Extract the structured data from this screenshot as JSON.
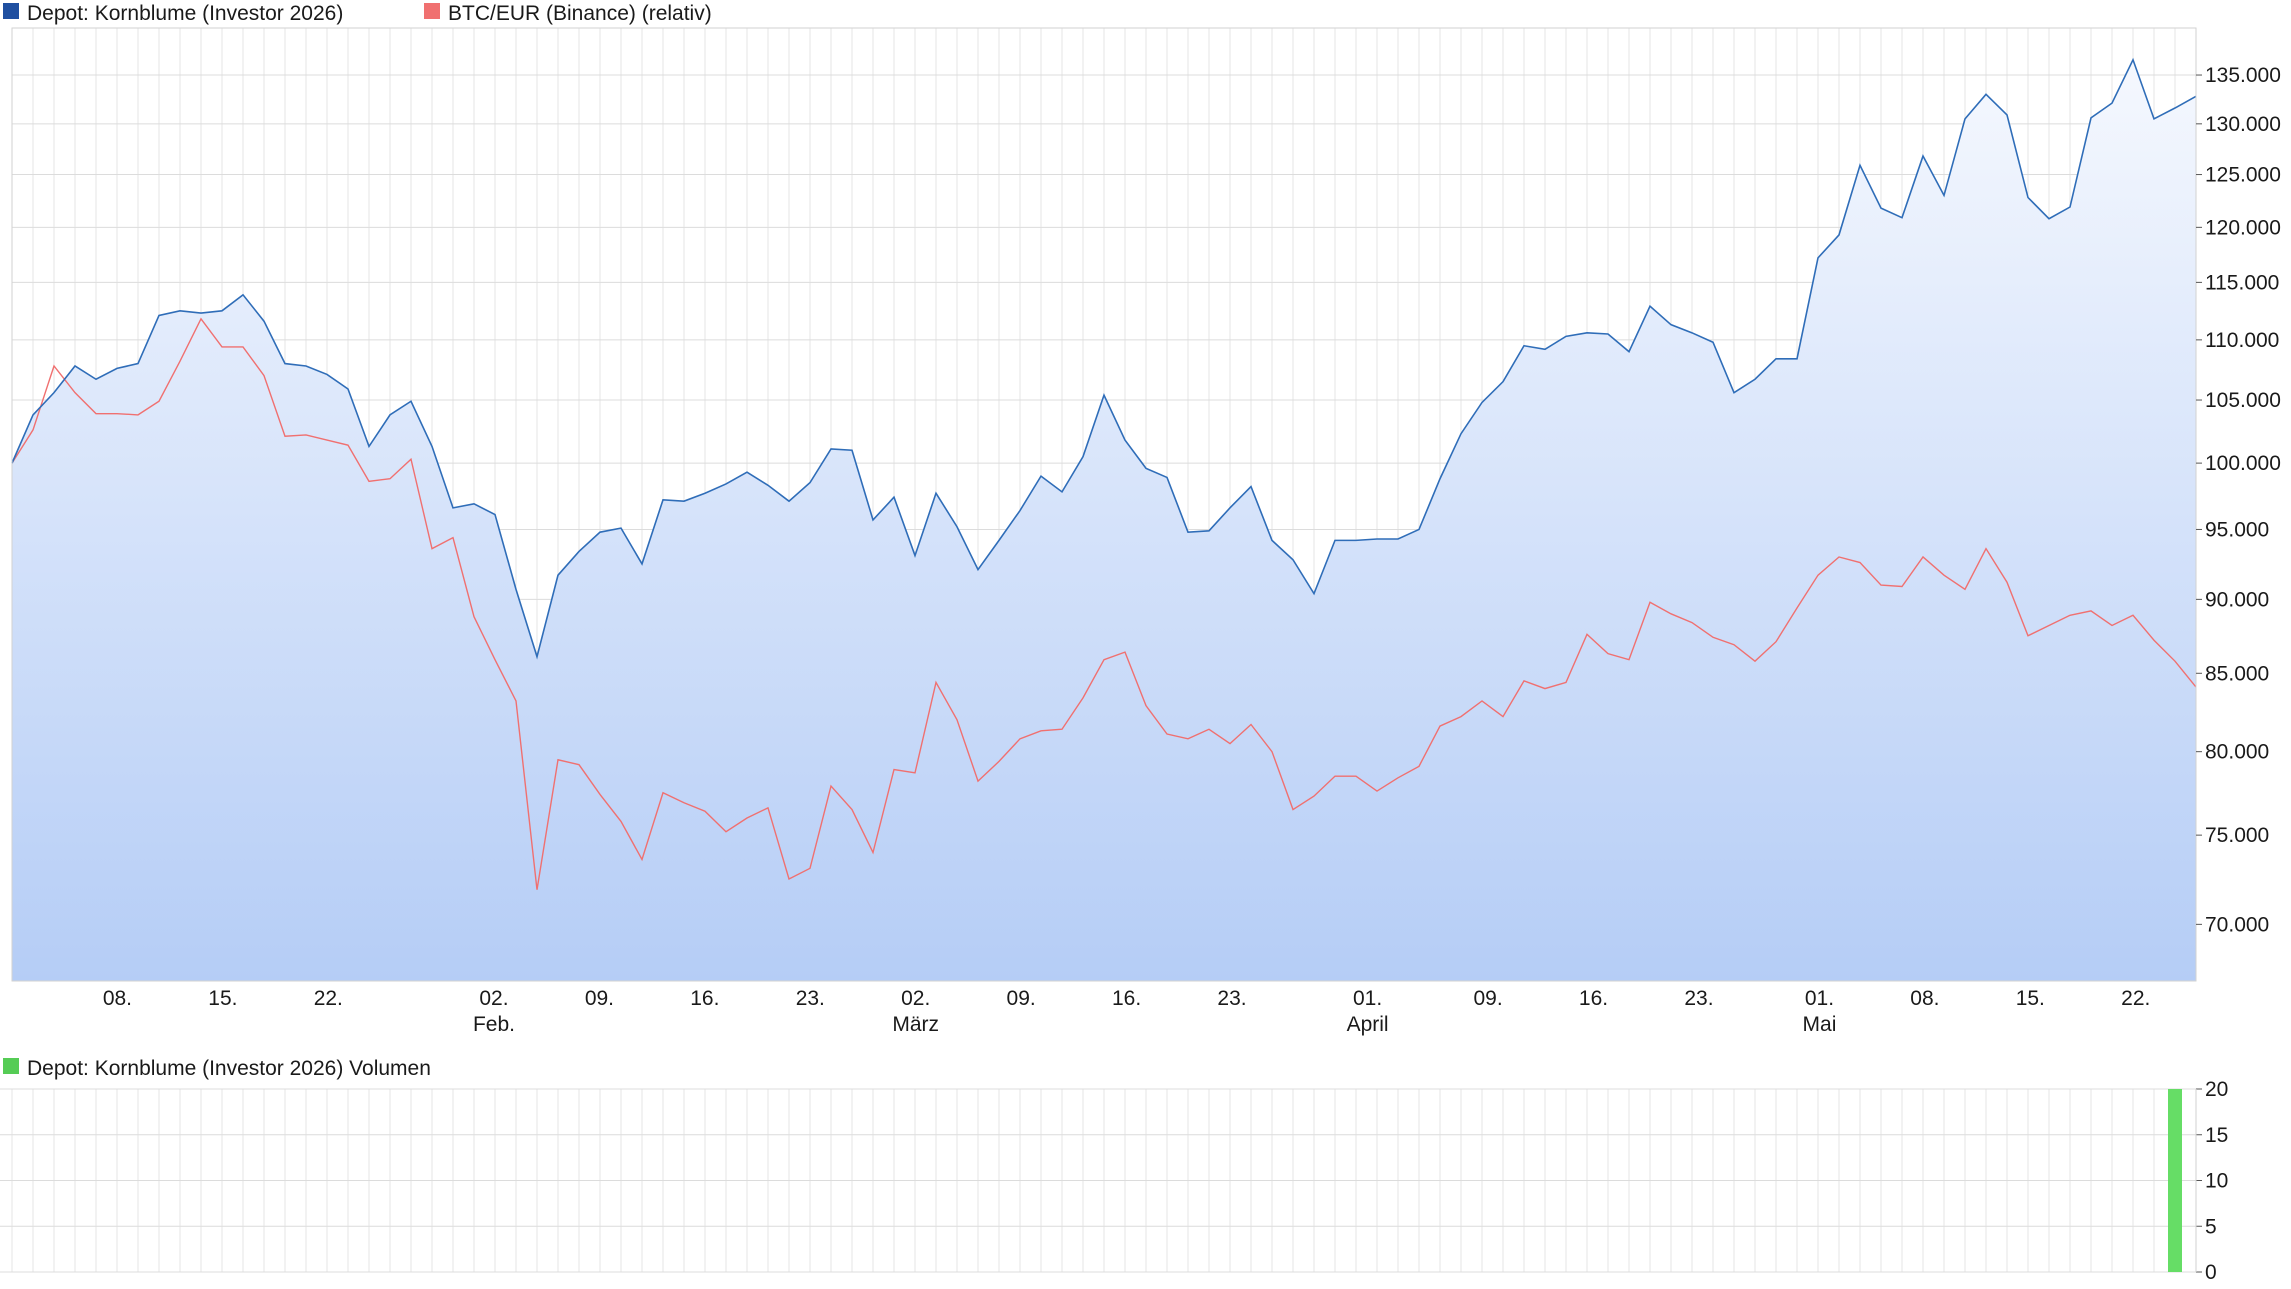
{
  "chart_data": [
    {
      "type": "line",
      "legend_position": "top-left",
      "grid": true,
      "y_scale": "log",
      "ylim": [
        67000,
        140000
      ],
      "y_ticks": [
        "70.000",
        "75.000",
        "80.000",
        "85.000",
        "90.000",
        "95.000",
        "100.000",
        "105.000",
        "110.000",
        "115.000",
        "120.000",
        "125.000",
        "130.000",
        "135.000"
      ],
      "y_tick_values": [
        70000,
        75000,
        80000,
        85000,
        90000,
        95000,
        100000,
        105000,
        110000,
        115000,
        120000,
        125000,
        130000,
        135000
      ],
      "x_ticks": [
        {
          "day": "08.",
          "month": "",
          "date": "2026-01-08"
        },
        {
          "day": "15.",
          "month": "",
          "date": "2026-01-15"
        },
        {
          "day": "22.",
          "month": "",
          "date": "2026-01-22"
        },
        {
          "day": "02.",
          "month": "Feb.",
          "date": "2026-02-02"
        },
        {
          "day": "09.",
          "month": "",
          "date": "2026-02-09"
        },
        {
          "day": "16.",
          "month": "",
          "date": "2026-02-16"
        },
        {
          "day": "23.",
          "month": "",
          "date": "2026-02-23"
        },
        {
          "day": "02.",
          "month": "März",
          "date": "2026-03-02"
        },
        {
          "day": "09.",
          "month": "",
          "date": "2026-03-09"
        },
        {
          "day": "16.",
          "month": "",
          "date": "2026-03-16"
        },
        {
          "day": "23.",
          "month": "",
          "date": "2026-03-23"
        },
        {
          "day": "01.",
          "month": "April",
          "date": "2026-04-01"
        },
        {
          "day": "09.",
          "month": "",
          "date": "2026-04-09"
        },
        {
          "day": "16.",
          "month": "",
          "date": "2026-04-16"
        },
        {
          "day": "23.",
          "month": "",
          "date": "2026-04-23"
        },
        {
          "day": "01.",
          "month": "Mai",
          "date": "2026-05-01"
        },
        {
          "day": "08.",
          "month": "",
          "date": "2026-05-08"
        },
        {
          "day": "15.",
          "month": "",
          "date": "2026-05-15"
        },
        {
          "day": "22.",
          "month": "",
          "date": "2026-05-22"
        }
      ],
      "series": [
        {
          "name": "Depot: Kornblume (Investor 2026)",
          "color": "#2f6db8",
          "fill_top": "#f5f8fe",
          "fill_bottom": "#b5cdf6",
          "legend_color": "#1f4fa0",
          "values": [
            100000,
            103800,
            105600,
            107800,
            106700,
            107600,
            108000,
            112100,
            112500,
            112300,
            112500,
            113900,
            111600,
            108000,
            107800,
            107100,
            105900,
            101300,
            103800,
            104900,
            101300,
            96600,
            96900,
            96100,
            90700,
            86100,
            91700,
            93400,
            94800,
            95100,
            92500,
            97200,
            97100,
            97700,
            98400,
            99300,
            98300,
            97100,
            98500,
            101100,
            101000,
            95700,
            97400,
            93100,
            97700,
            95200,
            92100,
            94200,
            96400,
            99000,
            97800,
            100500,
            105400,
            101800,
            99600,
            98900,
            94800,
            94900,
            96600,
            98200,
            94200,
            92800,
            90400,
            94200,
            94200,
            94300,
            94300,
            95000,
            98800,
            102300,
            104800,
            106500,
            109500,
            109200,
            110300,
            110600,
            110500,
            109000,
            112900,
            111300,
            110600,
            109800,
            105600,
            106700,
            108400,
            108400,
            117200,
            119300,
            125900,
            121800,
            120900,
            126800,
            123000,
            130500,
            133000,
            130900,
            122800,
            120800,
            121900,
            130600,
            132100,
            136600,
            130500,
            131600,
            132800
          ]
        },
        {
          "name": "BTC/EUR (Binance) (relativ)",
          "color": "#f07070",
          "legend_color": "#f07070",
          "values": [
            100000,
            102600,
            107800,
            105600,
            103900,
            103900,
            103800,
            104900,
            108200,
            111800,
            109400,
            109400,
            107000,
            102100,
            102200,
            101800,
            101400,
            98600,
            98800,
            100300,
            93600,
            94400,
            88800,
            85900,
            83200,
            71900,
            79500,
            79200,
            77400,
            75800,
            73600,
            77500,
            76900,
            76400,
            75200,
            76000,
            76600,
            72500,
            73100,
            77900,
            76500,
            74000,
            78900,
            78700,
            84400,
            82000,
            78200,
            79400,
            80800,
            81300,
            81400,
            83400,
            85900,
            86400,
            82900,
            81100,
            80800,
            81400,
            80500,
            81700,
            80000,
            76500,
            77300,
            78500,
            78500,
            77600,
            78400,
            79100,
            81600,
            82200,
            83200,
            82200,
            84500,
            84000,
            84400,
            87600,
            86300,
            85900,
            89800,
            89000,
            88400,
            87400,
            86900,
            85800,
            87100,
            89400,
            91700,
            93000,
            92600,
            91000,
            90900,
            93000,
            91700,
            90700,
            93600,
            91200,
            87500,
            88200,
            88900,
            89200,
            88200,
            88900,
            87200,
            85800,
            84100
          ]
        }
      ]
    },
    {
      "type": "bar",
      "legend_position": "top-left",
      "grid": true,
      "ylim": [
        0,
        20
      ],
      "y_ticks": [
        "0",
        "5",
        "10",
        "15",
        "20"
      ],
      "y_tick_values": [
        0,
        5,
        10,
        15,
        20
      ],
      "series": [
        {
          "name": "Depot: Kornblume (Investor 2026) Volumen",
          "color": "#66dd66",
          "legend_color": "#55cc55",
          "bars": [
            {
              "index": 103,
              "value": 20
            }
          ]
        }
      ]
    }
  ]
}
